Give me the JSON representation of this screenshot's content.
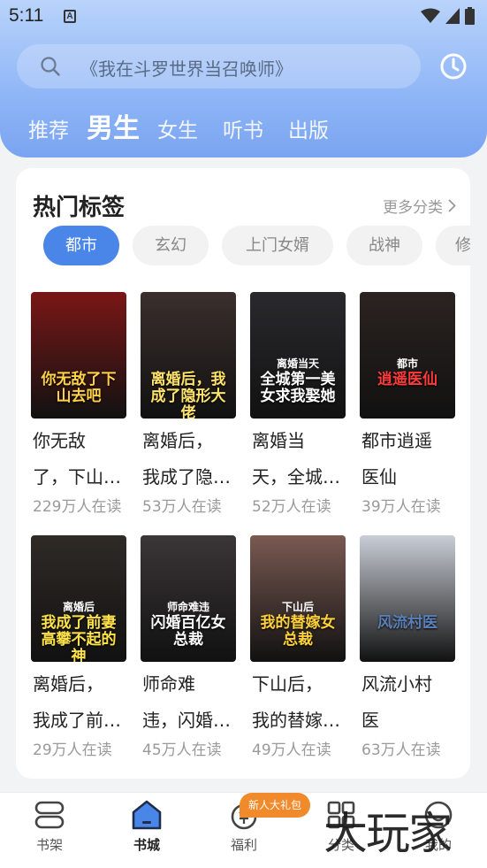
{
  "status_bar": {
    "time": "5:11",
    "indicator": "A"
  },
  "search": {
    "placeholder": "《我在斗罗世界当召唤师》"
  },
  "tabs": [
    {
      "label": "推荐",
      "active": false
    },
    {
      "label": "男生",
      "active": true
    },
    {
      "label": "女生",
      "active": false
    },
    {
      "label": "听书",
      "active": false
    },
    {
      "label": "出版",
      "active": false
    }
  ],
  "hot_tags": {
    "title": "热门标签",
    "more_label": "更多分类",
    "chips": [
      "都市",
      "玄幻",
      "上门女婿",
      "战神",
      "修"
    ]
  },
  "books": [
    {
      "title_line1": "你无敌",
      "title_line2": "了，下山…",
      "readers": "229万人在读",
      "cover_text": "你无敌了下山去吧",
      "cover_sub": "",
      "cover_color": "#7a1717"
    },
    {
      "title_line1": "离婚后，",
      "title_line2": "我成了隐…",
      "readers": "53万人在读",
      "cover_text": "离婚后，我成了隐形大佬",
      "cover_sub": "",
      "cover_color": "#3a2f2c"
    },
    {
      "title_line1": "离婚当",
      "title_line2": "天，全城…",
      "readers": "52万人在读",
      "cover_text": "全城第一美女求我娶她",
      "cover_sub": "离婚当天",
      "cover_color": "#2a2a2e"
    },
    {
      "title_line1": "都市逍遥",
      "title_line2": "医仙",
      "readers": "39万人在读",
      "cover_text": "逍遥医仙",
      "cover_sub": "都市",
      "cover_color": "#2b2320"
    },
    {
      "title_line1": "离婚后，",
      "title_line2": "我成了前…",
      "readers": "29万人在读",
      "cover_text": "我成了前妻高攀不起的神",
      "cover_sub": "离婚后",
      "cover_color": "#2f2a26"
    },
    {
      "title_line1": "师命难",
      "title_line2": "违，闪婚…",
      "readers": "45万人在读",
      "cover_text": "闪婚百亿女总裁",
      "cover_sub": "师命难违",
      "cover_color": "#3b3638"
    },
    {
      "title_line1": "下山后，",
      "title_line2": "我的替嫁…",
      "readers": "49万人在读",
      "cover_text": "我的替嫁女总裁",
      "cover_sub": "下山后",
      "cover_color": "#7a5a52"
    },
    {
      "title_line1": "风流小村",
      "title_line2": "医",
      "readers": "63万人在读",
      "cover_text": "风流村医",
      "cover_sub": "",
      "cover_color": "#c9ced6"
    }
  ],
  "bottom_nav": [
    {
      "label": "书架",
      "icon": "bookshelf-icon",
      "active": false
    },
    {
      "label": "书城",
      "icon": "bookstore-icon",
      "active": true
    },
    {
      "label": "福利",
      "icon": "welfare-icon",
      "active": false
    },
    {
      "label": "分类",
      "icon": "category-icon",
      "active": false
    },
    {
      "label": "我的",
      "icon": "profile-icon",
      "active": false
    }
  ],
  "gift_badge": "新人大礼包",
  "watermark": "大玩家",
  "colors": {
    "accent": "#4a86e8",
    "badge": "#f08a2b",
    "header_top": "#b9d3fb",
    "header_bottom": "#7aa4f1"
  }
}
